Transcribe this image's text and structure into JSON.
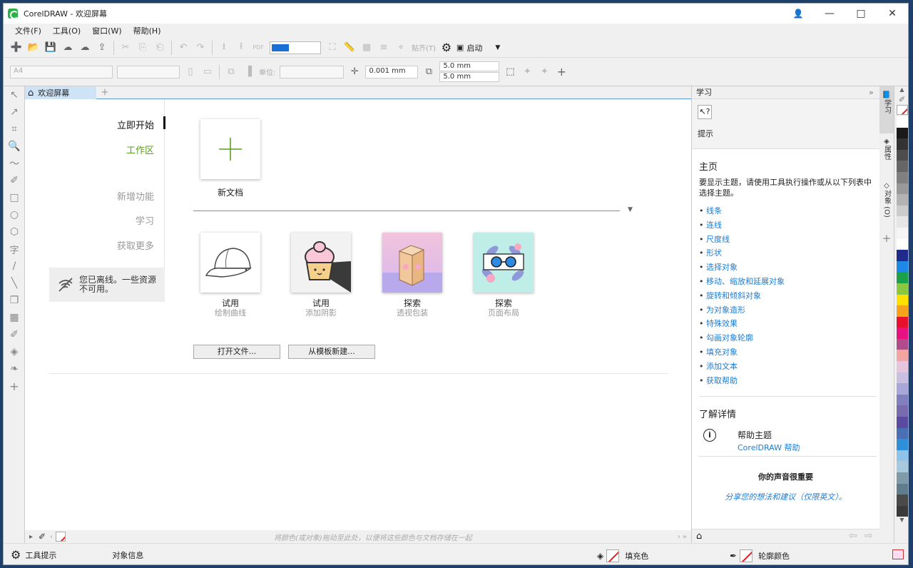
{
  "window": {
    "title": "CorelDRAW - 欢迎屏幕"
  },
  "menu": {
    "items": [
      "文件(F)",
      "工具(O)",
      "窗口(W)",
      "帮助(H)"
    ]
  },
  "toolbar": {
    "snap_label": "贴齐(T)",
    "launch_label": "启动",
    "pdf_label": "PDF"
  },
  "propbar": {
    "page_size": "A4",
    "units_label": "单位:",
    "nudge": "0.001 mm",
    "dup_x": "5.0 mm",
    "dup_y": "5.0 mm"
  },
  "tabs": {
    "welcome_tab": "欢迎屏幕"
  },
  "welcome": {
    "nav": {
      "get_started": "立即开始",
      "workspace": "工作区",
      "whats_new": "新增功能",
      "learn": "学习",
      "get_more": "获取更多"
    },
    "offline_message": "您已离线。一些资源不可用。",
    "new_document": "新文档",
    "cards": [
      {
        "title": "试用",
        "subtitle": "绘制曲线"
      },
      {
        "title": "试用",
        "subtitle": "添加阴影"
      },
      {
        "title": "探索",
        "subtitle": "透视包装"
      },
      {
        "title": "探索",
        "subtitle": "页面布局"
      }
    ],
    "open_file_button": "打开文件...",
    "new_from_template_button": "从模板新建..."
  },
  "colorbar": {
    "hint": "将颜色(或对象)拖动至此处，以便将这些颜色与文档存储在一起"
  },
  "status": {
    "tool_hints": "工具提示",
    "object_info": "对象信息",
    "fill_color": "填充色",
    "outline_color": "轮廓颜色"
  },
  "docker": {
    "title": "学习",
    "hints_label": "提示",
    "home_heading": "主页",
    "home_desc": "要显示主题，请使用工具执行操作或从以下列表中选择主题。",
    "topics": [
      "线条",
      "连线",
      "尺度线",
      "形状",
      "选择对象",
      "移动、缩放和延展对象",
      "旋转和倾斜对象",
      "为对象造形",
      "特殊效果",
      "勾画对象轮廓",
      "填充对象",
      "添加文本",
      "获取帮助"
    ],
    "learn_more_heading": "了解详情",
    "help_topics": "帮助主题",
    "help_link": "CorelDRAW 帮助",
    "feedback_heading": "你的声音很重要",
    "feedback_link": "分享您的想法和建议（仅限英文）。"
  },
  "side_tabs": [
    "学习",
    "属性",
    "对象 (O)"
  ],
  "colors": {
    "accent": "#1e7bd4",
    "green": "#5a9e1c",
    "palette": [
      "#ffffff",
      "#1a1a1a",
      "#333333",
      "#4d4d4d",
      "#666666",
      "#808080",
      "#999999",
      "#b3b3b3",
      "#cccccc",
      "#e6e6e6",
      "#f5f5f5",
      "#ffffff",
      "#1f2a8a",
      "#1e88e5",
      "#1aa14a",
      "#8dc63f",
      "#ffe000",
      "#f7a21b",
      "#e8112d",
      "#e8117f",
      "#b04b8c",
      "#f4a3a3",
      "#e5c4dc",
      "#c9bfe0",
      "#a9a6d8",
      "#8080c0",
      "#7a6bb0",
      "#5a4aa0",
      "#4a6fb5",
      "#2f8fd8",
      "#8fc3ea",
      "#a8c8dc",
      "#7f9aa8",
      "#607d8b",
      "#4a4a4a",
      "#3a3a3a"
    ]
  }
}
